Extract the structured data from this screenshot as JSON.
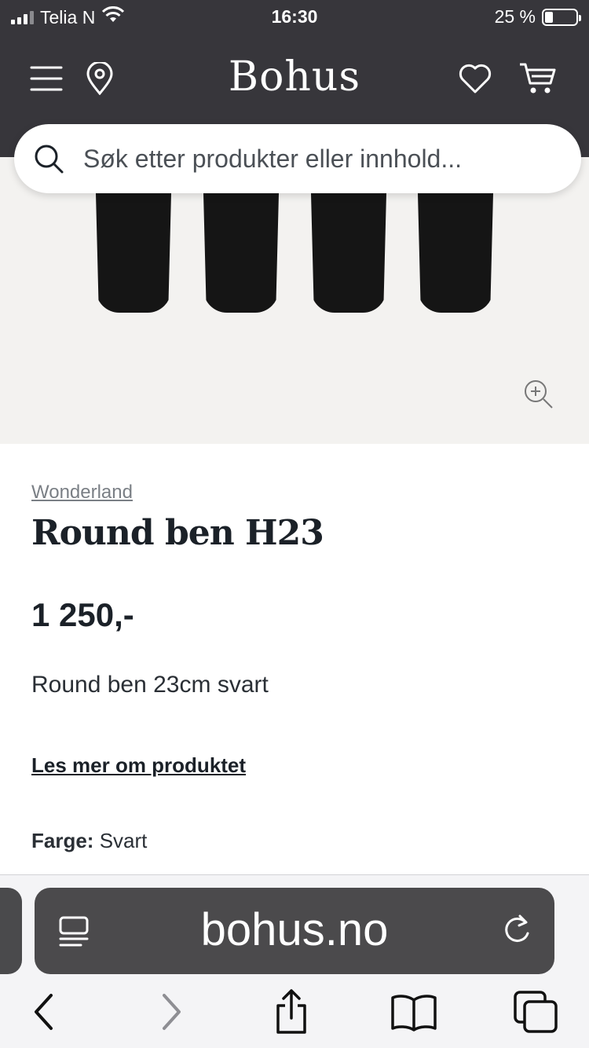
{
  "status_bar": {
    "carrier": "Telia N",
    "time": "16:30",
    "battery_percent": "25 %",
    "battery_level": 0.25
  },
  "header": {
    "logo": "Bohus",
    "icons": [
      "menu-icon",
      "location-pin-icon",
      "heart-icon",
      "cart-icon"
    ]
  },
  "search": {
    "placeholder": "Søk etter produkter eller innhold...",
    "value": ""
  },
  "product": {
    "brand": "Wonderland",
    "title": "Round ben H23",
    "price": "1 250,-",
    "description": "Round ben 23cm svart",
    "read_more": "Les mer om produktet",
    "color_label": "Farge:",
    "color_value": "Svart"
  },
  "browser": {
    "url": "bohus.no",
    "toolbar_icons": [
      "back-icon",
      "forward-icon",
      "share-icon",
      "bookmarks-icon",
      "tabs-icon"
    ]
  },
  "colors": {
    "header_bg": "#37363b",
    "image_bg": "#f3f2f0",
    "text_dark": "#1b2128"
  }
}
